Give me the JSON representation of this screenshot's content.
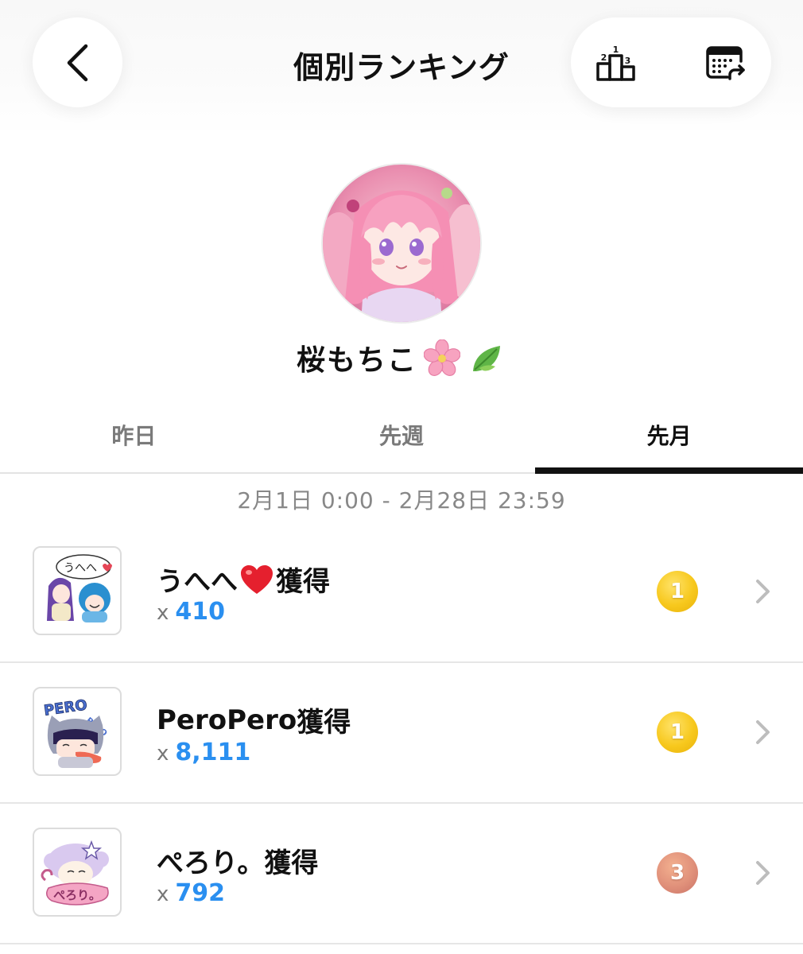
{
  "header": {
    "title": "個別ランキング",
    "back_icon": "chevron-left-icon",
    "actions": [
      {
        "icon": "podium-icon",
        "labels": [
          "1",
          "2",
          "3"
        ]
      },
      {
        "icon": "calendar-share-icon"
      }
    ]
  },
  "profile": {
    "name": "桜もちこ",
    "emojis": [
      "cherry-blossom-icon",
      "leaf-icon"
    ]
  },
  "tabs": [
    {
      "label": "昨日",
      "active": false
    },
    {
      "label": "先週",
      "active": false
    },
    {
      "label": "先月",
      "active": true
    }
  ],
  "date_range": "2月1日 0:00 - 2月28日 23:59",
  "rankings": [
    {
      "title_prefix": "うへへ",
      "title_suffix": "獲得",
      "title_icon": "heart-icon",
      "count_prefix": "x",
      "count": "410",
      "rank": "1",
      "medal": "gold",
      "sticker_text": "うへへ"
    },
    {
      "title_prefix": "PeroPero",
      "title_suffix": "獲得",
      "count_prefix": "x",
      "count": "8,111",
      "rank": "1",
      "medal": "gold",
      "sticker_text": "PERO"
    },
    {
      "title_prefix": "ぺろり。",
      "title_suffix": "獲得",
      "count_prefix": "x",
      "count": "792",
      "rank": "3",
      "medal": "bronze",
      "sticker_text": "ぺろり。"
    }
  ],
  "colors": {
    "accent_blue": "#2a8ff0",
    "gold": "#f7c81d",
    "bronze": "#e0907a",
    "active_tab": "#111111",
    "inactive_tab": "#7a7a7a"
  }
}
